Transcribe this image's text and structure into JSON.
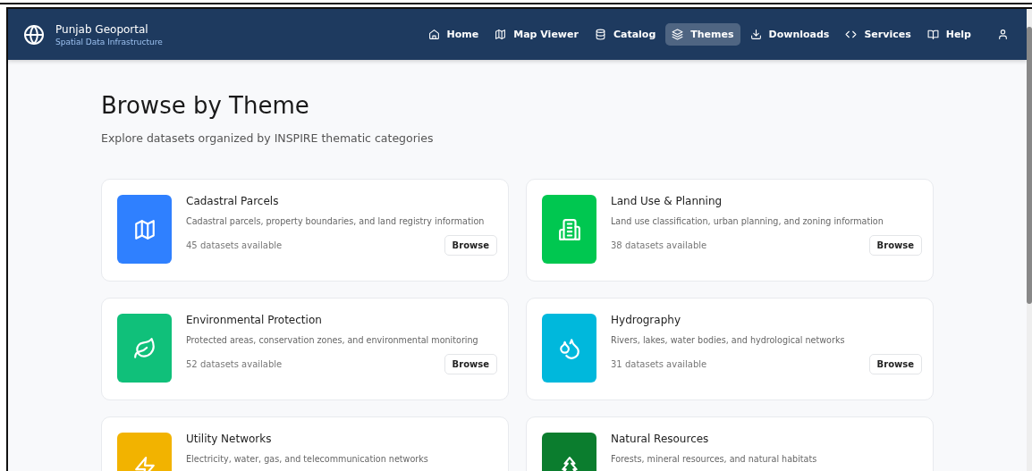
{
  "header": {
    "title": "Punjab Geoportal",
    "subtitle": "Spatial Data Infrastructure",
    "nav": [
      {
        "label": "Home",
        "kind": "home",
        "selected": false
      },
      {
        "label": "Map Viewer",
        "kind": "map",
        "selected": false
      },
      {
        "label": "Catalog",
        "kind": "database",
        "selected": false
      },
      {
        "label": "Themes",
        "kind": "layers",
        "selected": true
      },
      {
        "label": "Downloads",
        "kind": "download",
        "selected": false
      },
      {
        "label": "Services",
        "kind": "code",
        "selected": false
      },
      {
        "label": "Help",
        "kind": "book",
        "selected": false
      }
    ]
  },
  "page": {
    "title": "Browse by Theme",
    "subtitle": "Explore datasets organized by INSPIRE thematic categories"
  },
  "themes": [
    {
      "title": "Cadastral Parcels",
      "description": "Cadastral parcels, property boundaries, and land registry information",
      "count": "45 datasets available",
      "button": "Browse",
      "kind": "map",
      "color": "#2f80ff"
    },
    {
      "title": "Land Use & Planning",
      "description": "Land use classification, urban planning, and zoning information",
      "count": "38 datasets available",
      "button": "Browse",
      "kind": "building",
      "color": "#00c750"
    },
    {
      "title": "Environmental Protection",
      "description": "Protected areas, conservation zones, and environmental monitoring",
      "count": "52 datasets available",
      "button": "Browse",
      "kind": "leaf",
      "color": "#10c07a"
    },
    {
      "title": "Hydrography",
      "description": "Rivers, lakes, water bodies, and hydrological networks",
      "count": "31 datasets available",
      "button": "Browse",
      "kind": "droplets",
      "color": "#00b8dc"
    },
    {
      "title": "Utility Networks",
      "description": "Electricity, water, gas, and telecommunication networks",
      "kind": "zap",
      "color": "#f2b300"
    },
    {
      "title": "Natural Resources",
      "description": "Forests, mineral resources, and natural habitats",
      "kind": "tree",
      "color": "#0b7d2e"
    }
  ]
}
